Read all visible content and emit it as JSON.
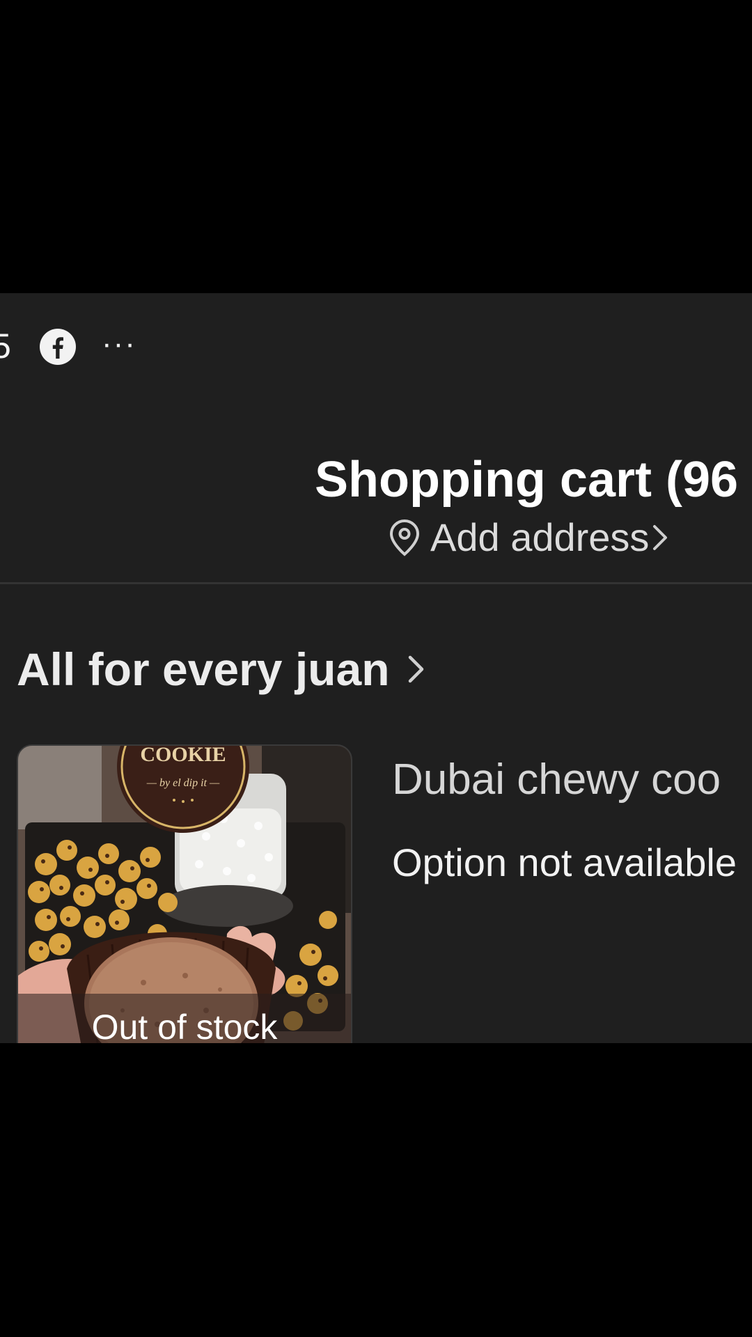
{
  "status_bar": {
    "partial_text": "5",
    "icons": [
      "facebook-icon",
      "more-icon"
    ],
    "more_label": "···"
  },
  "header": {
    "title": "Shopping cart (96",
    "address_label": "Add address",
    "address_icon": "location-pin-icon"
  },
  "store": {
    "name": "All for every juan",
    "chevron_icon": "chevron-right-icon"
  },
  "product": {
    "name": "Dubai chewy coo",
    "option": "Option not available",
    "stock_status": "Out of stock",
    "image_brand_text": "COOKIE",
    "image_tagline": "— by el dip it —"
  },
  "colors": {
    "app_background": "#1f1f1f",
    "letterbox": "#000000",
    "text_primary": "#ffffff",
    "text_secondary": "#d6d6d6"
  }
}
